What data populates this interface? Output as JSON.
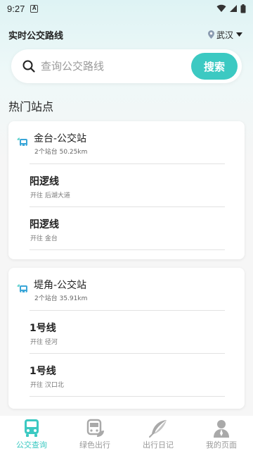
{
  "status_bar": {
    "time": "9:27",
    "notif_icon": "A"
  },
  "header": {
    "title": "实时公交路线",
    "city": "武汉"
  },
  "search": {
    "placeholder": "查询公交路线",
    "button_label": "搜索"
  },
  "hot_stops": {
    "title": "热门站点",
    "stops": [
      {
        "name": "金台-公交站",
        "info": "2个站台 50.25km",
        "routes": [
          {
            "name": "阳逻线",
            "direction": "开往 后湖大道"
          },
          {
            "name": "阳逻线",
            "direction": "开往 金台"
          }
        ]
      },
      {
        "name": "堤角-公交站",
        "info": "2个站台 35.91km",
        "routes": [
          {
            "name": "1号线",
            "direction": "开往 径河"
          },
          {
            "name": "1号线",
            "direction": "开往 汉口北"
          }
        ]
      }
    ]
  },
  "tabs": [
    {
      "label": "公交查询",
      "icon": "bus-icon",
      "active": true
    },
    {
      "label": "绿色出行",
      "icon": "green-bus-icon",
      "active": false
    },
    {
      "label": "出行日记",
      "icon": "feather-icon",
      "active": false
    },
    {
      "label": "我的页面",
      "icon": "user-icon",
      "active": false
    }
  ],
  "colors": {
    "accent": "#3cc9c2",
    "tab_inactive": "#999999",
    "background": "#f6f6f6"
  }
}
